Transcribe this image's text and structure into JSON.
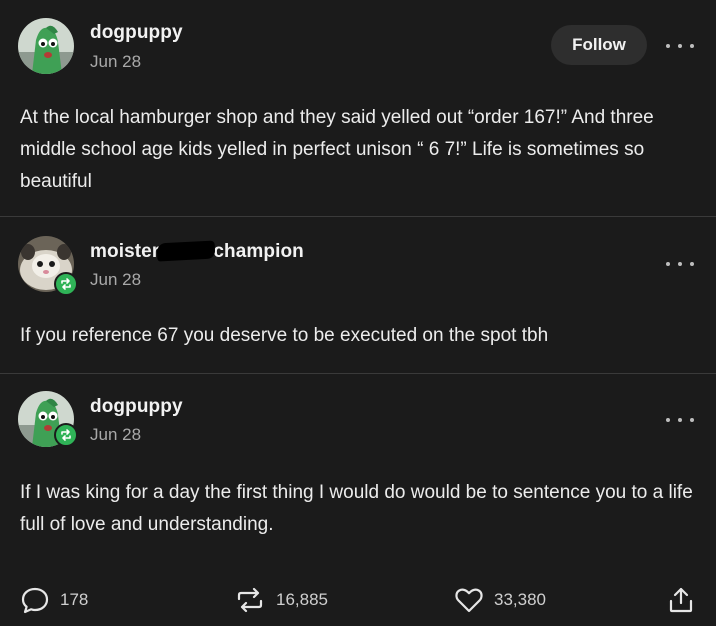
{
  "posts": [
    {
      "username": "dogpuppy",
      "date": "Jun 28",
      "follow_label": "Follow",
      "body": "At the local hamburger shop and they said yelled out “order 167!” And three middle school age kids yelled in perfect unison “ 6 7!” Life is sometimes so beautiful",
      "avatar_icon": "gumby-avatar"
    },
    {
      "username_start": "moister",
      "username_end": "champion",
      "date": "Jun 28",
      "body": "If you reference 67 you deserve to be executed on the spot tbh",
      "avatar_icon": "possum-avatar",
      "badge_icon": "reblog-icon"
    },
    {
      "username": "dogpuppy",
      "date": "Jun 28",
      "body": "If I was king for a day the first thing I would do would be to sentence you to a life full of love and understanding.",
      "avatar_icon": "gumby-avatar",
      "badge_icon": "reblog-icon"
    }
  ],
  "actions": {
    "replies": "178",
    "reblogs": "16,885",
    "likes": "33,380"
  },
  "colors": {
    "background": "#1b1b1b",
    "reblog_badge": "#2fb357",
    "divider": "#3a3a3a"
  }
}
